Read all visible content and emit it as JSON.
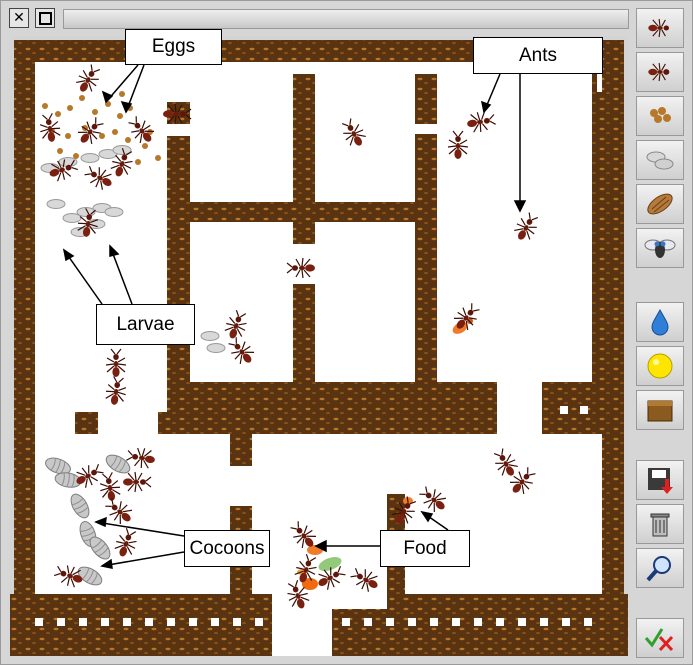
{
  "window": {
    "close_icon": "close-icon",
    "maximize_icon": "maximize-icon"
  },
  "labels": {
    "eggs": "Eggs",
    "ants": "Ants",
    "larvae": "Larvae",
    "cocoons": "Cocoons",
    "food": "Food"
  },
  "toolbar": [
    {
      "name": "tool-ant-worker",
      "icon": "ant-icon"
    },
    {
      "name": "tool-ant-soldier",
      "icon": "ant-icon"
    },
    {
      "name": "tool-eggs",
      "icon": "eggs-icon"
    },
    {
      "name": "tool-larvae",
      "icon": "larva-icon"
    },
    {
      "name": "tool-cocoon",
      "icon": "cocoon-icon"
    },
    {
      "name": "tool-fly",
      "icon": "fly-icon"
    },
    {
      "name": "tool-water",
      "icon": "water-drop-icon"
    },
    {
      "name": "tool-sugar",
      "icon": "yellow-ball-icon"
    },
    {
      "name": "tool-dirt",
      "icon": "dirt-block-icon"
    },
    {
      "name": "tool-save",
      "icon": "save-icon"
    },
    {
      "name": "tool-delete",
      "icon": "trash-icon"
    },
    {
      "name": "tool-inspect",
      "icon": "magnifier-icon"
    },
    {
      "name": "tool-ok-cancel",
      "icon": "check-cross-icon"
    }
  ],
  "colors": {
    "wall": "#5a3410",
    "wall_dot": "#c88a3a",
    "floor": "#ffffff",
    "ant": "#6b1a0a"
  }
}
